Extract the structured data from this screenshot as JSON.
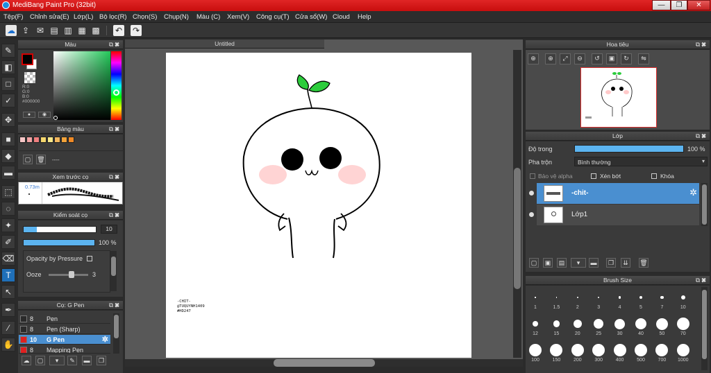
{
  "window": {
    "title": "MediBang Paint Pro (32bit)",
    "buttons": [
      "—",
      "❐",
      "✕"
    ]
  },
  "menu": [
    "Tệp(F)",
    "Chỉnh sửa(E)",
    "Lớp(L)",
    "Bộ lọc(R)",
    "Chọn(S)",
    "Chụp(N)",
    "Màu (C)",
    "Xem(V)",
    "Công cụ(T)",
    "Cửa sổ(W)",
    "Cloud",
    "Help"
  ],
  "panels": {
    "color": {
      "title": "Màu",
      "rgb": [
        "R:0",
        "G:0",
        "B:0",
        "#000000"
      ],
      "colors": {
        "foreground": "#000000",
        "background": "#ffffff",
        "accent_border": "#d40000"
      }
    },
    "palette": {
      "title": "Bảng màu",
      "colors": [
        "#f6c7c7",
        "#f2a4a4",
        "#f08080",
        "#f5d76e",
        "#f7e88a",
        "#f2b75e",
        "#f2a33a",
        "#f08a26"
      ],
      "label": "----"
    },
    "brush_preview": {
      "title": "Xem trước cọ",
      "size_label": "0.73m"
    },
    "brush_control": {
      "title": "Kiểm soát cọ",
      "size_value": "10",
      "opacity_value": "100 %",
      "opacity_level": 1.0,
      "opacity_pressure_label": "Opacity by Pressure",
      "ooze_label": "Ooze",
      "ooze_value": "3"
    },
    "brush_list": {
      "title": "Cọ: G Pen",
      "items": [
        {
          "size": "8",
          "name": "Pen",
          "color": "#2a2a2a"
        },
        {
          "size": "8",
          "name": "Pen (Sharp)",
          "color": "#2a2a2a"
        },
        {
          "size": "10",
          "name": "G Pen",
          "color": "#e02020"
        },
        {
          "size": "8",
          "name": "Mapping Pen",
          "color": "#e02020"
        }
      ]
    },
    "navigator": {
      "title": "Hoa tiêu"
    },
    "layers": {
      "title": "Lớp",
      "opacity_label": "Độ trong",
      "opacity_value": "100 %",
      "opacity_level": 1.0,
      "blend_label": "Pha trộn",
      "blend_value": "Bình thường",
      "protect_alpha": "Bảo vệ alpha",
      "clipping": "Xén bớt",
      "lock": "Khóa",
      "items": [
        {
          "name": "-chit-",
          "selected": true
        },
        {
          "name": "Lớp1",
          "selected": false
        }
      ]
    },
    "brush_size": {
      "title": "Brush Size",
      "sizes": [
        "1",
        "1.5",
        "2",
        "3",
        "4",
        "5",
        "7",
        "10",
        "12",
        "15",
        "20",
        "25",
        "30",
        "40",
        "50",
        "70",
        "100",
        "150",
        "200",
        "300",
        "400",
        "500",
        "700",
        "1000"
      ]
    }
  },
  "canvas": {
    "tab_title": "Untitled",
    "signature": [
      "-CHIT-",
      "@TUQUYNH1409",
      "#HD247"
    ]
  },
  "icons": {
    "toolbar": [
      "cloud-icon",
      "share-icon",
      "comment-icon",
      "document-icon",
      "page-icon",
      "grid-icon",
      "frame-icon",
      "undo-icon",
      "redo-icon"
    ],
    "tools": [
      "brush-icon",
      "eraser-icon",
      "rectangle-icon",
      "select-pen-icon",
      "move-icon",
      "fill-rect-icon",
      "bucket-icon",
      "gradient-icon",
      "marquee-icon",
      "lasso-icon",
      "magic-wand-icon",
      "select-brush-icon",
      "select-eraser-icon",
      "text-icon",
      "operation-icon",
      "dropper-icon",
      "eyedropper-icon",
      "hand-icon"
    ]
  }
}
